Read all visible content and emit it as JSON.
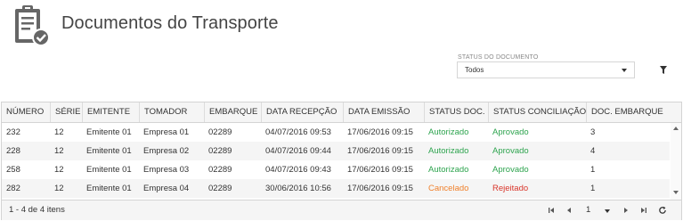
{
  "page": {
    "title": "Documentos do Transporte"
  },
  "filter": {
    "label": "STATUS DO DOCUMENTO",
    "selected": "Todos"
  },
  "colors": {
    "green": "#2ea44f",
    "orange": "#f0812c",
    "red": "#d9362b"
  },
  "table": {
    "columns": [
      "NÚMERO",
      "SÉRIE",
      "EMITENTE",
      "TOMADOR",
      "EMBARQUE",
      "DATA RECEPÇÃO",
      "DATA EMISSÃO",
      "STATUS DOC.",
      "STATUS CONCILIAÇÃO",
      "DOC. EMBARQUE"
    ],
    "rows": [
      {
        "numero": "232",
        "serie": "12",
        "emitente": "Emitente 01",
        "tomador": "Empresa 01",
        "embarque": "02289",
        "recepcao": "04/07/2016 09:53",
        "emissao": "17/06/2016 09:15",
        "status_doc": "Autorizado",
        "status_conc": "Aprovado",
        "doc_embarque": "3"
      },
      {
        "numero": "228",
        "serie": "12",
        "emitente": "Emitente 01",
        "tomador": "Empresa 02",
        "embarque": "02289",
        "recepcao": "04/07/2016 09:44",
        "emissao": "17/06/2016 09:15",
        "status_doc": "Autorizado",
        "status_conc": "Aprovado",
        "doc_embarque": "4"
      },
      {
        "numero": "258",
        "serie": "12",
        "emitente": "Emitente 01",
        "tomador": "Empresa 03",
        "embarque": "02289",
        "recepcao": "04/07/2016 09:43",
        "emissao": "17/06/2016 09:15",
        "status_doc": "Autorizado",
        "status_conc": "Aprovado",
        "doc_embarque": "1"
      },
      {
        "numero": "282",
        "serie": "12",
        "emitente": "Emitente 01",
        "tomador": "Empresa 04",
        "embarque": "02289",
        "recepcao": "30/06/2016 10:56",
        "emissao": "17/06/2016 09:15",
        "status_doc": "Cancelado",
        "status_conc": "Rejeitado",
        "doc_embarque": "1"
      }
    ]
  },
  "pager": {
    "info": "1 - 4 de 4 itens",
    "page": "1"
  }
}
